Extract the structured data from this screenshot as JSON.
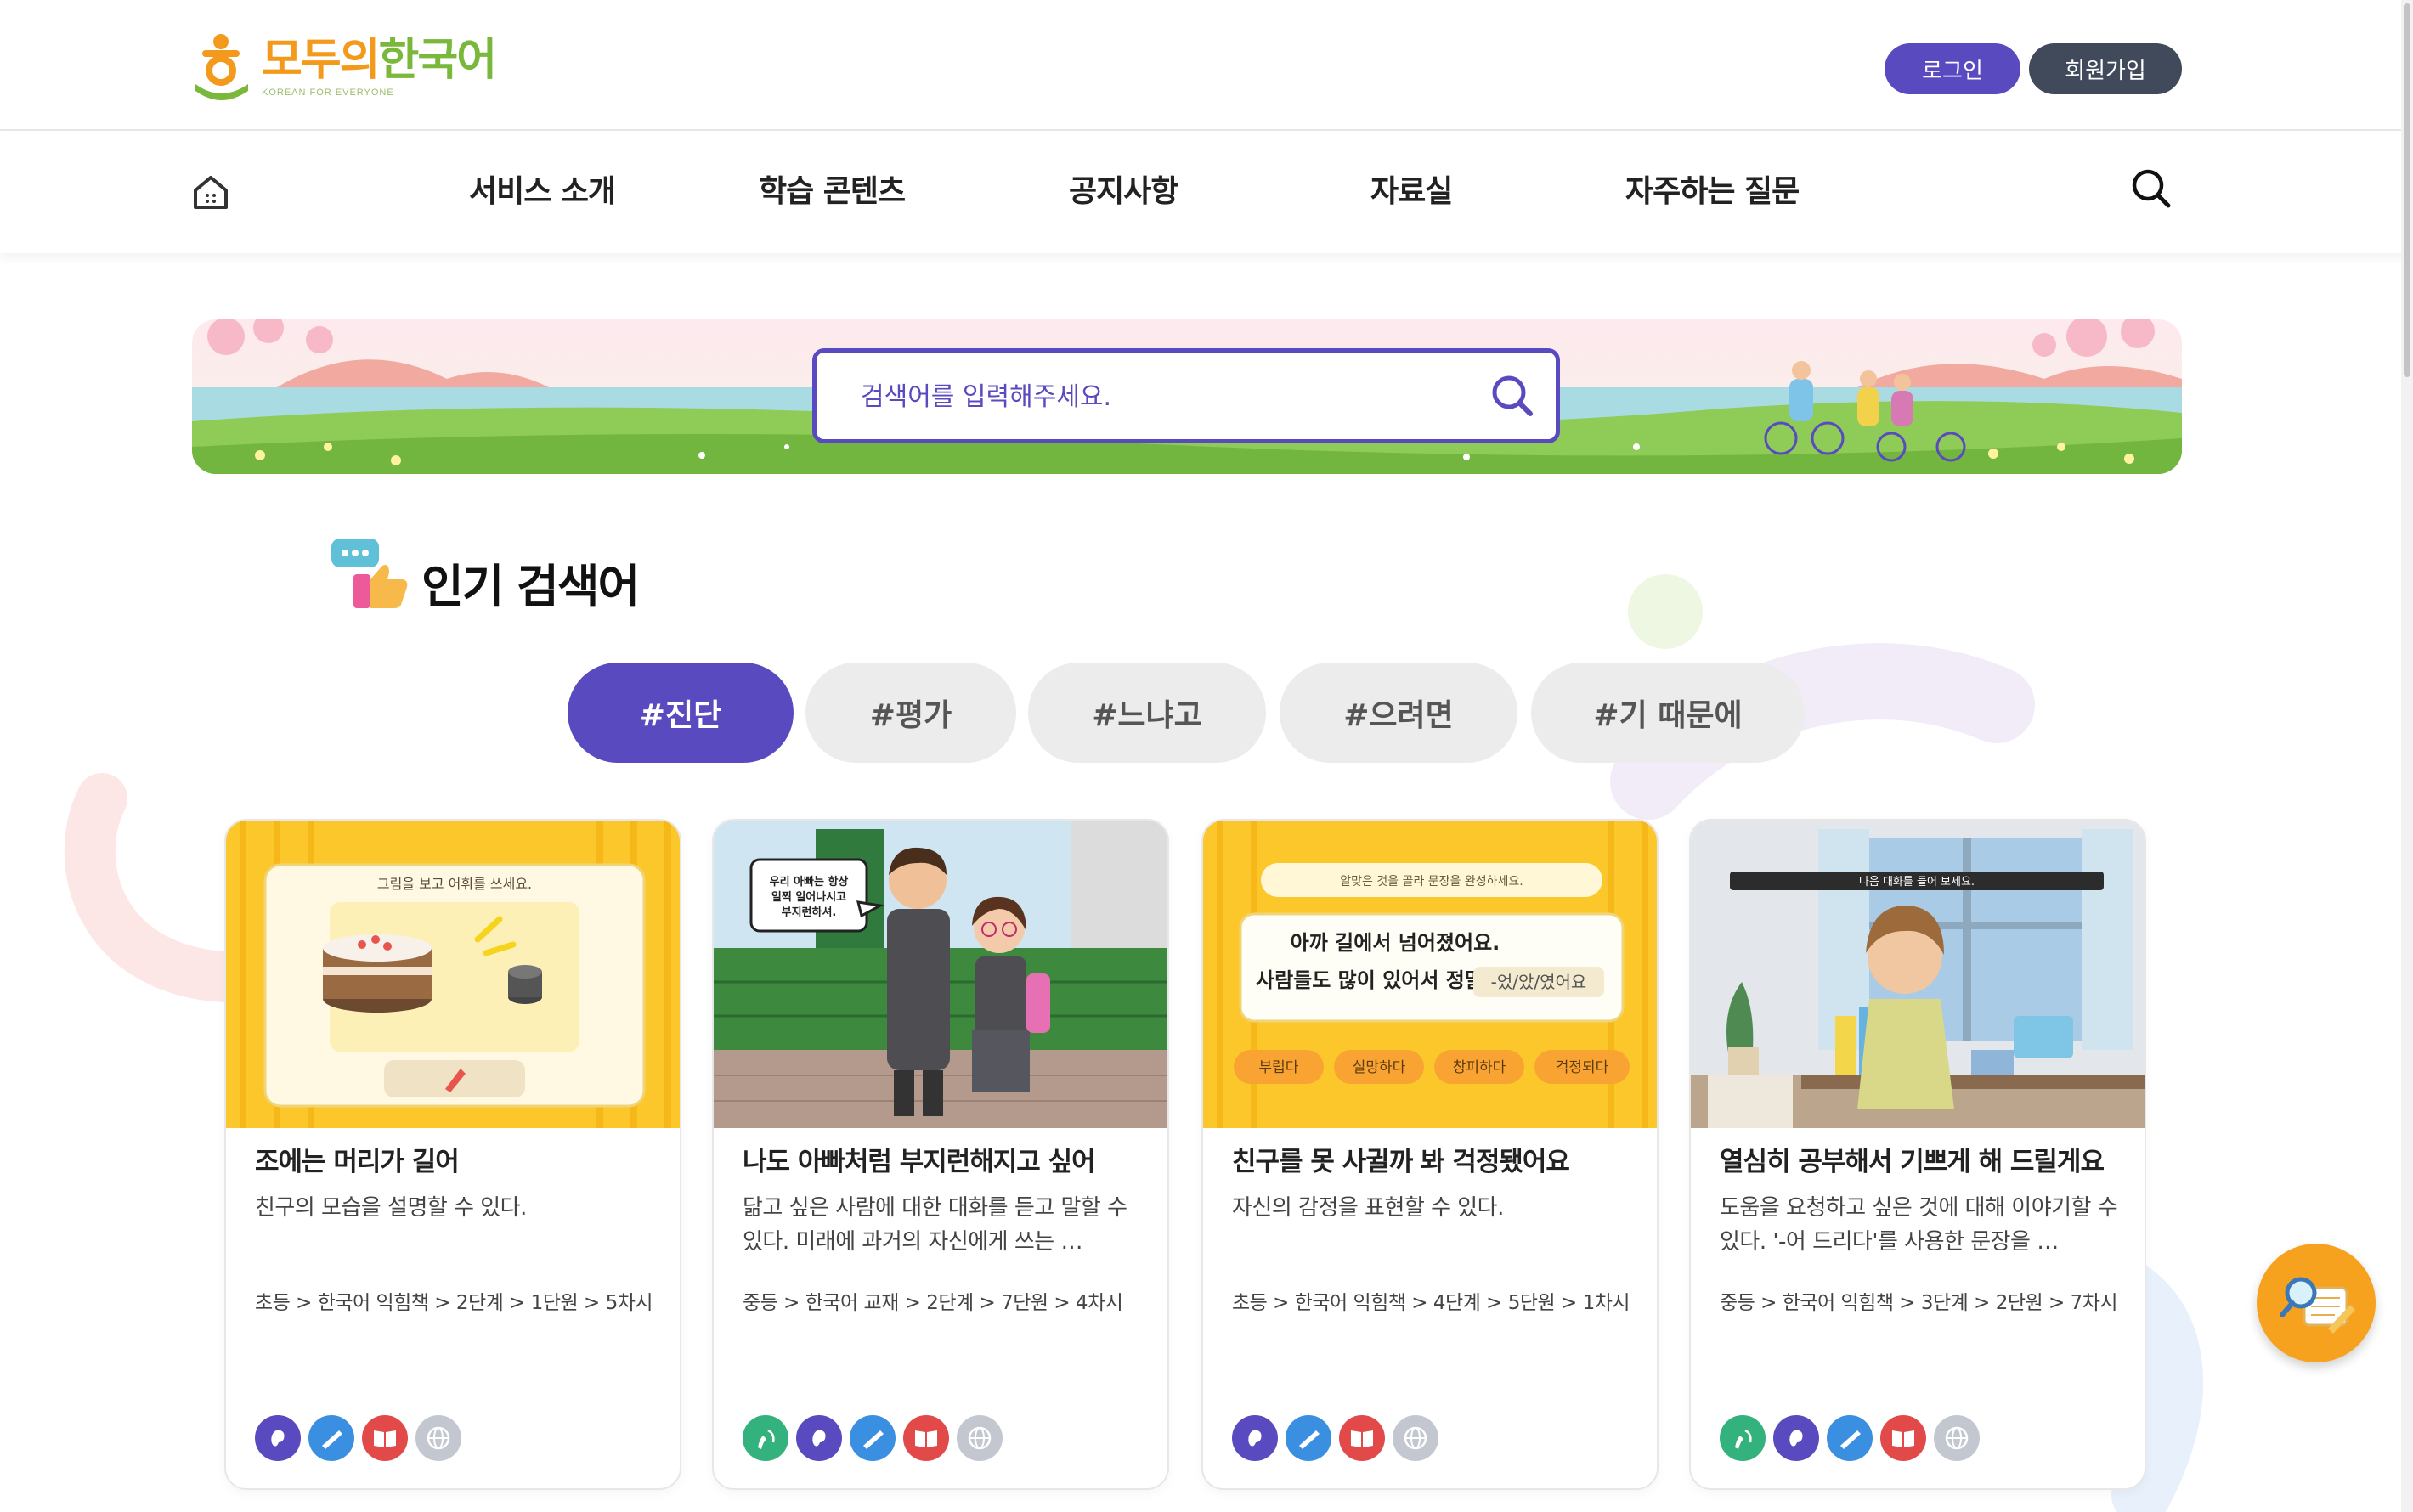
{
  "header": {
    "logo_title_a": "모두의",
    "logo_title_b": "한국어",
    "logo_sub": "KOREAN FOR EVERYONE",
    "login": "로그인",
    "join": "회원가입"
  },
  "nav": {
    "home_icon": "home-icon",
    "items": [
      "서비스 소개",
      "학습 콘텐츠",
      "공지사항",
      "자료실",
      "자주하는 질문"
    ],
    "search_icon": "search-icon"
  },
  "search": {
    "placeholder": "검색어를 입력해주세요."
  },
  "popular": {
    "title": "인기 검색어",
    "chips": [
      "#진단",
      "#평가",
      "#느냐고",
      "#으려면",
      "#기 때문에"
    ]
  },
  "cards": [
    {
      "title": "조에는 머리가 길어",
      "desc": "친구의 모습을 설명할 수 있다.",
      "path": "초등 > 한국어 익힘책 > 2단계 > 1단원 > 5차시",
      "image": {
        "instruction": "그림을 보고 어휘를 쓰세요."
      },
      "icons": [
        "listening-icon",
        "writing-icon",
        "reading-icon",
        "culture-icon"
      ]
    },
    {
      "title": "나도 아빠처럼 부지런해지고 싶어",
      "desc": "닮고 싶은 사람에 대한 대화를 듣고 말할 수 있다. 미래에 과거의 자신에게 쓰는 …",
      "path": "중등 > 한국어 교재 > 2단계 > 7단원 > 4차시",
      "image": {
        "bubble": [
          "우리 아빠는 항상",
          "일찍 일어나시고",
          "부지런하셔."
        ]
      },
      "icons": [
        "speaking-icon",
        "listening-icon",
        "writing-icon",
        "reading-icon",
        "culture-icon"
      ]
    },
    {
      "title": "친구를 못 사귈까 봐 걱정됐어요",
      "desc": "자신의 감정을 표현할 수 있다.",
      "path": "초등 > 한국어 익힘책 > 4단계 > 5단원 > 1차시",
      "image": {
        "instruction": "알맞은 것을 골라 문장을 완성하세요.",
        "line1": "아까 길에서 넘어졌어요.",
        "line2": "사람들도 많이 있어서 정말",
        "blank": "-었/았/였어요",
        "options": [
          "부럽다",
          "실망하다",
          "창피하다",
          "걱정되다"
        ]
      },
      "icons": [
        "listening-icon",
        "writing-icon",
        "reading-icon",
        "culture-icon"
      ]
    },
    {
      "title": "열심히 공부해서 기쁘게 해 드릴게요",
      "desc": "도움을 요청하고 싶은 것에 대해 이야기할 수 있다. '-어 드리다'를 사용한 문장을 …",
      "path": "중등 > 한국어 익힘책 > 3단계 > 2단원 > 7차시",
      "image": {
        "instruction": "다음 대화를 들어 보세요."
      },
      "icons": [
        "speaking-icon",
        "listening-icon",
        "writing-icon",
        "reading-icon",
        "culture-icon"
      ]
    }
  ],
  "colors": {
    "primary": "#5a4ac0",
    "dark_button": "#414a5a",
    "logo_orange": "#f39a1c",
    "logo_green": "#79b83a",
    "card_yellow": "#fbc72b",
    "float_button": "#f6a21e"
  },
  "float_button_icon": "study-search-icon"
}
